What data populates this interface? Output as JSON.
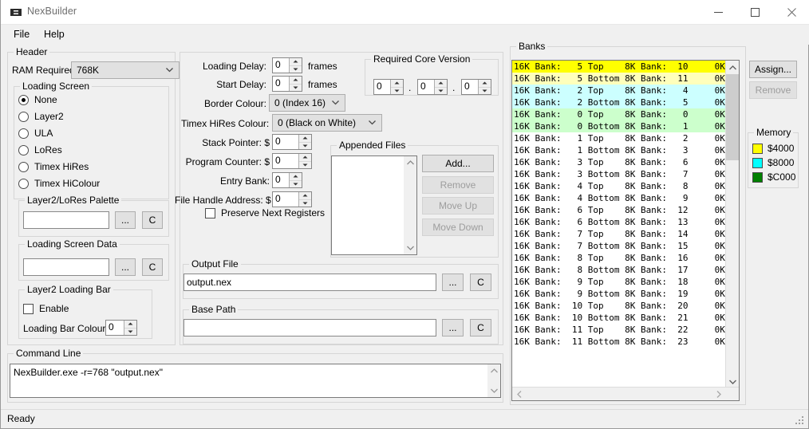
{
  "window": {
    "title": "NexBuilder",
    "icon": "nexbuilder-logo-icon",
    "minimize_label": "—",
    "maximize_label": "□",
    "close_label": "✕"
  },
  "menubar": {
    "items": [
      {
        "label": "File"
      },
      {
        "label": "Help"
      }
    ]
  },
  "header": {
    "group_label": "Header",
    "ram_required_label": "RAM Required:",
    "ram_required_value": "768K",
    "loading_screen": {
      "group_label": "Loading Screen",
      "options": [
        {
          "label": "None",
          "selected": true
        },
        {
          "label": "Layer2",
          "selected": false
        },
        {
          "label": "ULA",
          "selected": false
        },
        {
          "label": "LoRes",
          "selected": false
        },
        {
          "label": "Timex HiRes",
          "selected": false
        },
        {
          "label": "Timex HiColour",
          "selected": false
        }
      ]
    },
    "palette": {
      "group_label": "Layer2/LoRes Palette",
      "value": "",
      "browse_label": "...",
      "clear_label": "C"
    },
    "screen_data": {
      "group_label": "Loading Screen Data",
      "value": "",
      "browse_label": "...",
      "clear_label": "C"
    },
    "loading_bar": {
      "group_label": "Layer2 Loading Bar",
      "enable_label": "Enable",
      "enable_checked": false,
      "colour_label": "Loading Bar Colour:",
      "colour_value": "0"
    }
  },
  "middle": {
    "loading_delay_label": "Loading Delay:",
    "loading_delay_value": "0",
    "loading_delay_unit": "frames",
    "start_delay_label": "Start Delay:",
    "start_delay_value": "0",
    "start_delay_unit": "frames",
    "border_colour_label": "Border Colour:",
    "border_colour_value": "0   (Index 16)",
    "timex_hires_label": "Timex HiRes Colour:",
    "timex_hires_value": "0   (Black on White)",
    "stack_pointer_label": "Stack Pointer: $",
    "stack_pointer_value": "0",
    "program_counter_label": "Program Counter: $",
    "program_counter_value": "0",
    "entry_bank_label": "Entry Bank:",
    "entry_bank_value": "0",
    "file_handle_label": "File Handle Address: $",
    "file_handle_value": "0",
    "preserve_label": "Preserve Next Registers",
    "preserve_checked": false,
    "core_version": {
      "group_label": "Required Core Version",
      "major": "0",
      "minor": "0",
      "patch": "0",
      "separator": "."
    },
    "appended_files": {
      "group_label": "Appended Files",
      "items": [],
      "add_label": "Add...",
      "remove_label": "Remove",
      "move_up_label": "Move Up",
      "move_down_label": "Move Down"
    },
    "output_file": {
      "group_label": "Output File",
      "value": "output.nex",
      "browse_label": "...",
      "clear_label": "C"
    },
    "base_path": {
      "group_label": "Base Path",
      "value": "",
      "browse_label": "...",
      "clear_label": "C"
    }
  },
  "banks": {
    "group_label": "Banks",
    "assign_label": "Assign...",
    "remove_label": "Remove",
    "memory_label": "Memory",
    "legend": [
      {
        "label": "$4000",
        "color": "#ffff00"
      },
      {
        "label": "$8000",
        "color": "#00ffff"
      },
      {
        "label": "$C000",
        "color": "#008000"
      }
    ],
    "rows": [
      {
        "text": "16K Bank:   5 Top    8K Bank:  10     0K",
        "bg": "#ffff00"
      },
      {
        "text": "16K Bank:   5 Bottom 8K Bank:  11     0K",
        "bg": "#ffffbb"
      },
      {
        "text": "16K Bank:   2 Top    8K Bank:   4     0K",
        "bg": "#ccffff"
      },
      {
        "text": "16K Bank:   2 Bottom 8K Bank:   5     0K",
        "bg": "#ccffff"
      },
      {
        "text": "16K Bank:   0 Top    8K Bank:   0     0K",
        "bg": "#ccffcc"
      },
      {
        "text": "16K Bank:   0 Bottom 8K Bank:   1     0K",
        "bg": "#ccffcc"
      },
      {
        "text": "16K Bank:   1 Top    8K Bank:   2     0K",
        "bg": "#ffffff"
      },
      {
        "text": "16K Bank:   1 Bottom 8K Bank:   3     0K",
        "bg": "#ffffff"
      },
      {
        "text": "16K Bank:   3 Top    8K Bank:   6     0K",
        "bg": "#ffffff"
      },
      {
        "text": "16K Bank:   3 Bottom 8K Bank:   7     0K",
        "bg": "#ffffff"
      },
      {
        "text": "16K Bank:   4 Top    8K Bank:   8     0K",
        "bg": "#ffffff"
      },
      {
        "text": "16K Bank:   4 Bottom 8K Bank:   9     0K",
        "bg": "#ffffff"
      },
      {
        "text": "16K Bank:   6 Top    8K Bank:  12     0K",
        "bg": "#ffffff"
      },
      {
        "text": "16K Bank:   6 Bottom 8K Bank:  13     0K",
        "bg": "#ffffff"
      },
      {
        "text": "16K Bank:   7 Top    8K Bank:  14     0K",
        "bg": "#ffffff"
      },
      {
        "text": "16K Bank:   7 Bottom 8K Bank:  15     0K",
        "bg": "#ffffff"
      },
      {
        "text": "16K Bank:   8 Top    8K Bank:  16     0K",
        "bg": "#ffffff"
      },
      {
        "text": "16K Bank:   8 Bottom 8K Bank:  17     0K",
        "bg": "#ffffff"
      },
      {
        "text": "16K Bank:   9 Top    8K Bank:  18     0K",
        "bg": "#ffffff"
      },
      {
        "text": "16K Bank:   9 Bottom 8K Bank:  19     0K",
        "bg": "#ffffff"
      },
      {
        "text": "16K Bank:  10 Top    8K Bank:  20     0K",
        "bg": "#ffffff"
      },
      {
        "text": "16K Bank:  10 Bottom 8K Bank:  21     0K",
        "bg": "#ffffff"
      },
      {
        "text": "16K Bank:  11 Top    8K Bank:  22     0K",
        "bg": "#ffffff"
      },
      {
        "text": "16K Bank:  11 Bottom 8K Bank:  23     0K",
        "bg": "#ffffff"
      }
    ]
  },
  "command_line": {
    "group_label": "Command Line",
    "value": "NexBuilder.exe -r=768 \"output.nex\""
  },
  "statusbar": {
    "text": "Ready"
  }
}
